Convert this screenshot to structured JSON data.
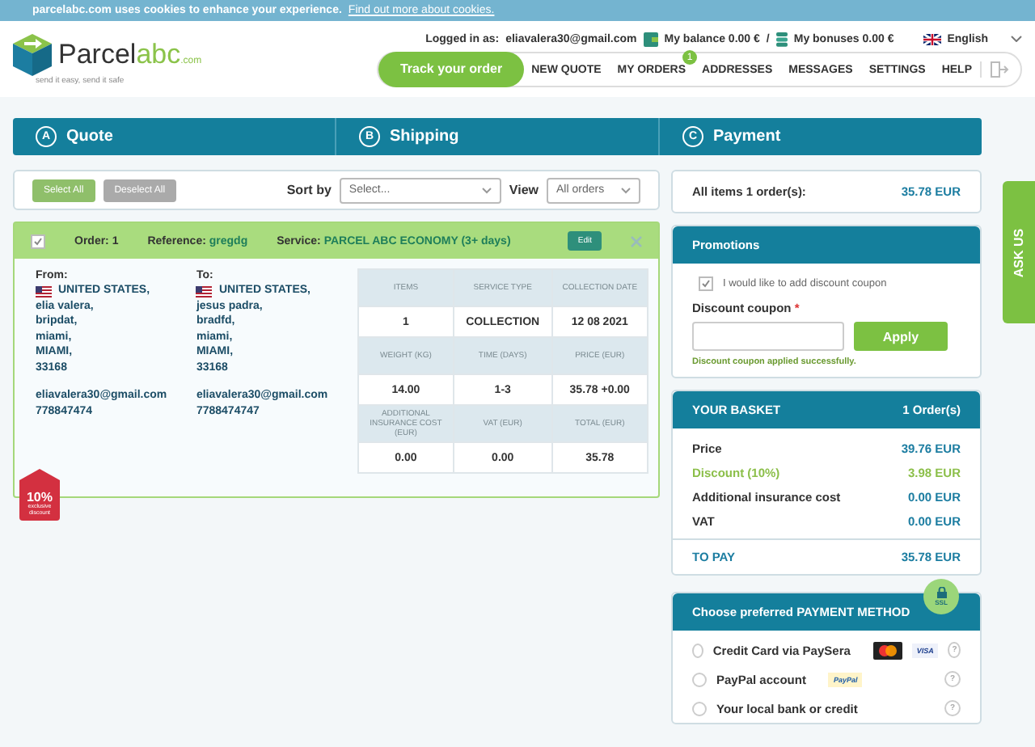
{
  "cookie_bar": {
    "text": "parcelabc.com uses cookies to enhance your experience.",
    "link": "Find out more about cookies."
  },
  "header": {
    "logo": {
      "name": "Parcel",
      "accent": "abc",
      "suffix": ".com",
      "tagline": "send it easy, send it safe"
    },
    "logged_in_label": "Logged in as:",
    "email": "eliavalera30@gmail.com",
    "balance": "My balance 0.00 €",
    "separator": "/",
    "bonuses": "My bonuses 0.00 €",
    "language": "English"
  },
  "nav": {
    "track": "Track your order",
    "items": [
      {
        "label": "NEW QUOTE"
      },
      {
        "label": "MY ORDERS",
        "badge": "1"
      },
      {
        "label": "ADDRESSES"
      },
      {
        "label": "MESSAGES"
      },
      {
        "label": "SETTINGS"
      },
      {
        "label": "HELP"
      }
    ]
  },
  "steps": [
    {
      "letter": "A",
      "label": "Quote"
    },
    {
      "letter": "B",
      "label": "Shipping"
    },
    {
      "letter": "C",
      "label": "Payment"
    }
  ],
  "toolbar": {
    "select_all": "Select All",
    "deselect_all": "Deselect All",
    "sort_label": "Sort by",
    "sort_placeholder": "Select...",
    "view_label": "View",
    "view_value": "All orders"
  },
  "order": {
    "checked": true,
    "order_label": "Order: 1",
    "reference_label": "Reference:",
    "reference": "gregdg",
    "service_label": "Service:",
    "service": "PARCEL ABC ECONOMY (3+ days)",
    "edit": "Edit",
    "addresses": [
      {
        "label": "From:",
        "country": "UNITED STATES,",
        "lines": [
          "elia valera,",
          "bripdat,",
          "miami,",
          "MIAMI,",
          "33168"
        ],
        "email": "eliavalera30@gmail.com",
        "phone": "778847474"
      },
      {
        "label": "To:",
        "country": "UNITED STATES,",
        "lines": [
          "jesus padra,",
          "bradfd,",
          "miami,",
          "MIAMI,",
          "33168"
        ],
        "email": "eliavalera30@gmail.com",
        "phone": "7788474747"
      }
    ],
    "table": [
      [
        {
          "head": "ITEMS",
          "value": "1"
        },
        {
          "head": "SERVICE TYPE",
          "value": "COLLECTION"
        },
        {
          "head": "COLLECTION DATE",
          "value": "12 08 2021"
        }
      ],
      [
        {
          "head": "WEIGHT (KG)",
          "value": "14.00"
        },
        {
          "head": "TIME (DAYS)",
          "value": "1-3"
        },
        {
          "head": "PRICE (EUR)",
          "value": "35.78 +0.00"
        }
      ],
      [
        {
          "head": "ADDITIONAL INSURANCE COST (EUR)",
          "value": "0.00"
        },
        {
          "head": "VAT (EUR)",
          "value": "0.00"
        },
        {
          "head": "TOTAL (EUR)",
          "value": "35.78"
        }
      ]
    ],
    "discount_tag": {
      "percent": "10%",
      "text": "exclusive discount"
    }
  },
  "summary": {
    "label": "All items 1 order(s):",
    "value": "35.78 EUR"
  },
  "promotions": {
    "title": "Promotions",
    "checkbox_label": "I would like to add discount coupon",
    "checked": true,
    "coupon_label": "Discount coupon",
    "required": "*",
    "apply": "Apply",
    "success": "Discount coupon applied successfully."
  },
  "basket": {
    "title": "YOUR BASKET",
    "count": "1 Order(s)",
    "rows": [
      {
        "label": "Price",
        "value": "39.76 EUR",
        "kind": "normal"
      },
      {
        "label": "Discount (10%)",
        "value": "3.98 EUR",
        "kind": "discount"
      },
      {
        "label": "Additional insurance cost",
        "value": "0.00 EUR",
        "kind": "normal"
      },
      {
        "label": "VAT",
        "value": "0.00 EUR",
        "kind": "normal"
      }
    ],
    "total_label": "TO PAY",
    "total": "35.78 EUR"
  },
  "payment": {
    "title": "Choose preferred PAYMENT METHOD",
    "ssl": "SSL",
    "methods": [
      {
        "label": "Credit Card via PaySera",
        "selected": false,
        "help": "?",
        "logos": [
          {
            "kind": "mastercard"
          },
          {
            "kind": "visa",
            "text": "VISA"
          }
        ]
      },
      {
        "label": "PayPal account",
        "selected": false,
        "help": "?",
        "logos": [
          {
            "kind": "paypal",
            "text": "PayPal"
          }
        ]
      },
      {
        "label": "Your local bank or credit",
        "selected": false,
        "help": "?"
      }
    ]
  },
  "ask_us": "ASK US"
}
